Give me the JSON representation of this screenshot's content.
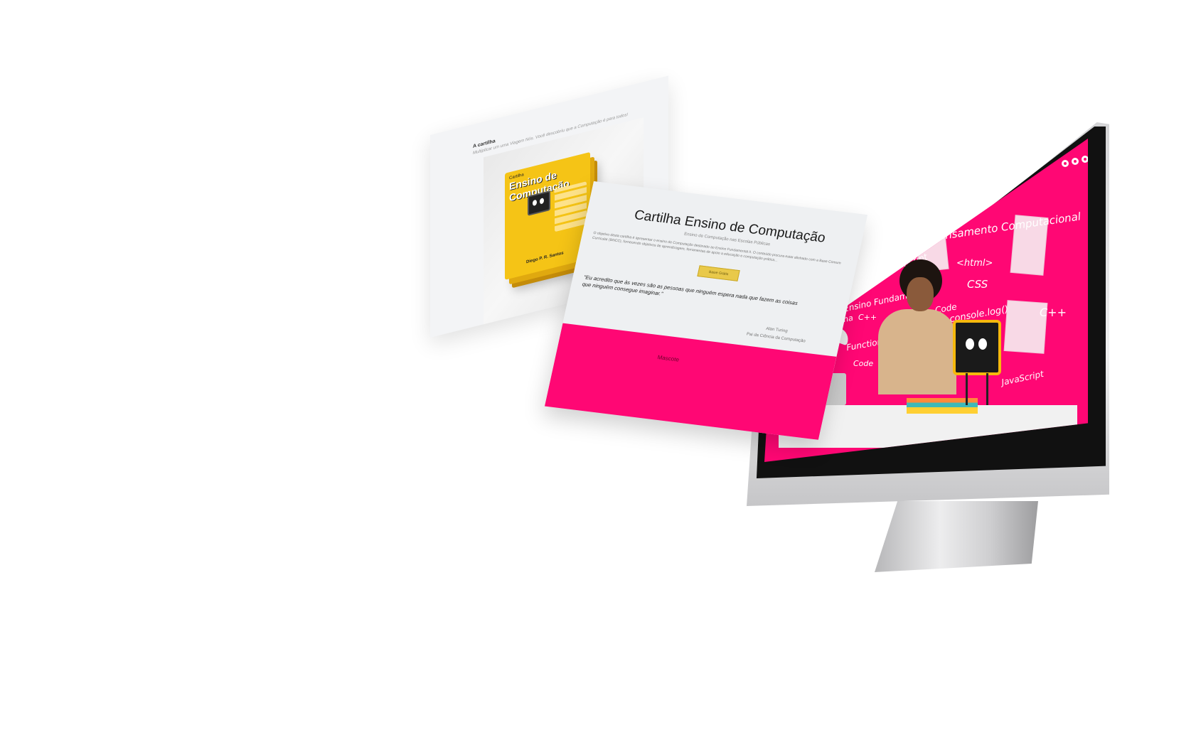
{
  "book_page": {
    "header": "A cartilha",
    "subtitle": "Multiplicar um uma Viagem Nós. Você descobriu que a Computação é para todos!",
    "cover_small": "Cartilha",
    "cover_title": "Ensino de Computação",
    "cover_author": "Diego P. R. Santos"
  },
  "landing": {
    "title": "Cartilha Ensino de Computação",
    "subtitle": "Ensino de Computação nas Escolas Públicas",
    "paragraph": "O objetivo desta cartilha é apresentar o ensino de Computação destinado ao Ensino Fundamental II. O conteúdo procura estar alinhado com a Base Comum Curricular (BNCC), fornecendo objetivos de aprendizagem, ferramentas de apoio a educação e computação prática...",
    "button_label": "Baixe Grátis",
    "quote": "\"Eu acredito que às vezes são as pessoas que ninguém espera nada que fazem as coisas que ninguém consegue imaginar.\"",
    "quote_author": "Alan Turing",
    "quote_role": "Pai da Ciência da Computação",
    "footer_label": "Mascote"
  },
  "monitor_screen": {
    "words": [
      "Pensamento Computacional",
      "<html>",
      "JavaScript",
      "CSS",
      "Ensino Fundamental",
      "Code",
      "console.log()",
      "C++",
      "Cartilha",
      "C++",
      "Function()",
      "Code",
      "JavaScript"
    ],
    "accent": "#ff0774"
  },
  "icons": [
    "mascot-icon",
    "twitter-icon",
    "instagram-icon"
  ]
}
